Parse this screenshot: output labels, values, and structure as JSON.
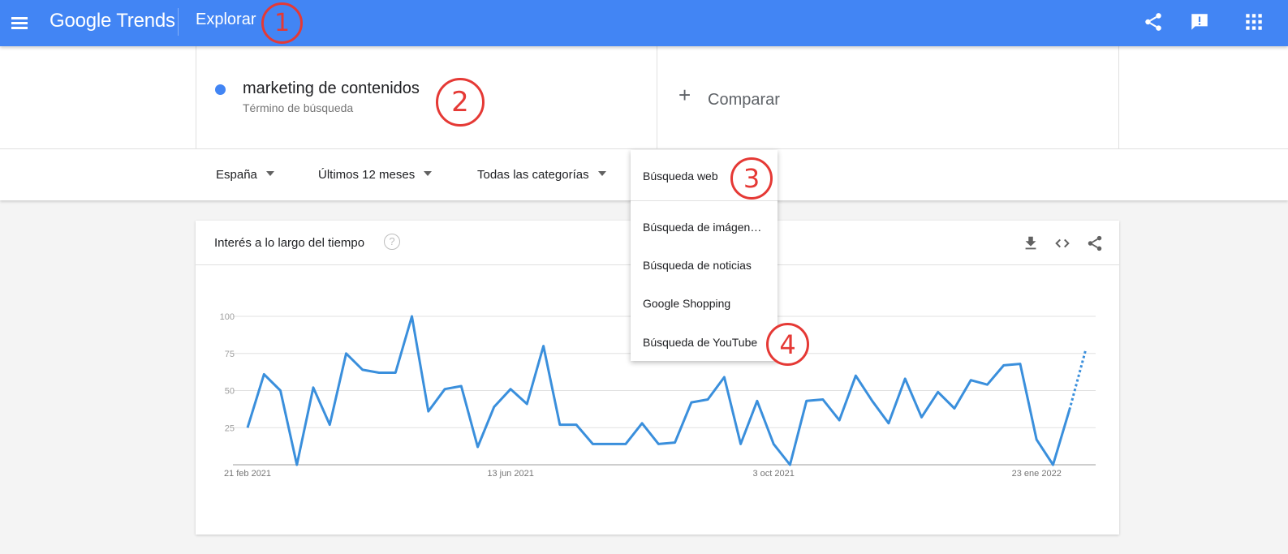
{
  "header": {
    "logo_text": "Google Trends",
    "section_title": "Explorar",
    "icons": [
      "menu-icon",
      "share-icon",
      "feedback-icon",
      "apps-icon"
    ],
    "bar_color": "#4285f4"
  },
  "search": {
    "term": {
      "name": "marketing de contenidos",
      "type_label": "Término de búsqueda",
      "color": "#4285f4"
    },
    "compare_label": "Comparar"
  },
  "filters": {
    "region": "España",
    "time_range": "Últimos 12 meses",
    "category": "Todas las categorías"
  },
  "search_type_menu": {
    "items": [
      "Búsqueda web",
      "Búsqueda de imágen…",
      "Búsqueda de noticias",
      "Google Shopping",
      "Búsqueda de YouTube"
    ],
    "selected": "Búsqueda web"
  },
  "annotations": [
    "1",
    "2",
    "3",
    "4"
  ],
  "card": {
    "title": "Interés a lo largo del tiempo",
    "help_glyph": "?",
    "actions": [
      "download-icon",
      "embed-icon",
      "share-icon"
    ]
  },
  "chart_data": {
    "type": "line",
    "series": [
      {
        "color": "#3a8fdc",
        "values": [
          25,
          61,
          50,
          0,
          52,
          27,
          75,
          64,
          62,
          62,
          100,
          36,
          51,
          53,
          12,
          39,
          51,
          41,
          80,
          27,
          27,
          14,
          14,
          14,
          28,
          14,
          15,
          42,
          44,
          59,
          14,
          43,
          14,
          0,
          43,
          44,
          30,
          60,
          43,
          28,
          58,
          32,
          49,
          38,
          57,
          54,
          67,
          68,
          17,
          0,
          37,
          78
        ],
        "partial_last_point": true
      }
    ],
    "x_labels": [
      "21 feb 2021",
      "13 jun 2021",
      "3 oct 2021",
      "23 ene 2022"
    ],
    "x_label_indices": [
      0,
      16,
      32,
      48
    ],
    "y_ticks": [
      100,
      75,
      50,
      25
    ],
    "ylim": [
      0,
      100
    ],
    "grid": true
  }
}
